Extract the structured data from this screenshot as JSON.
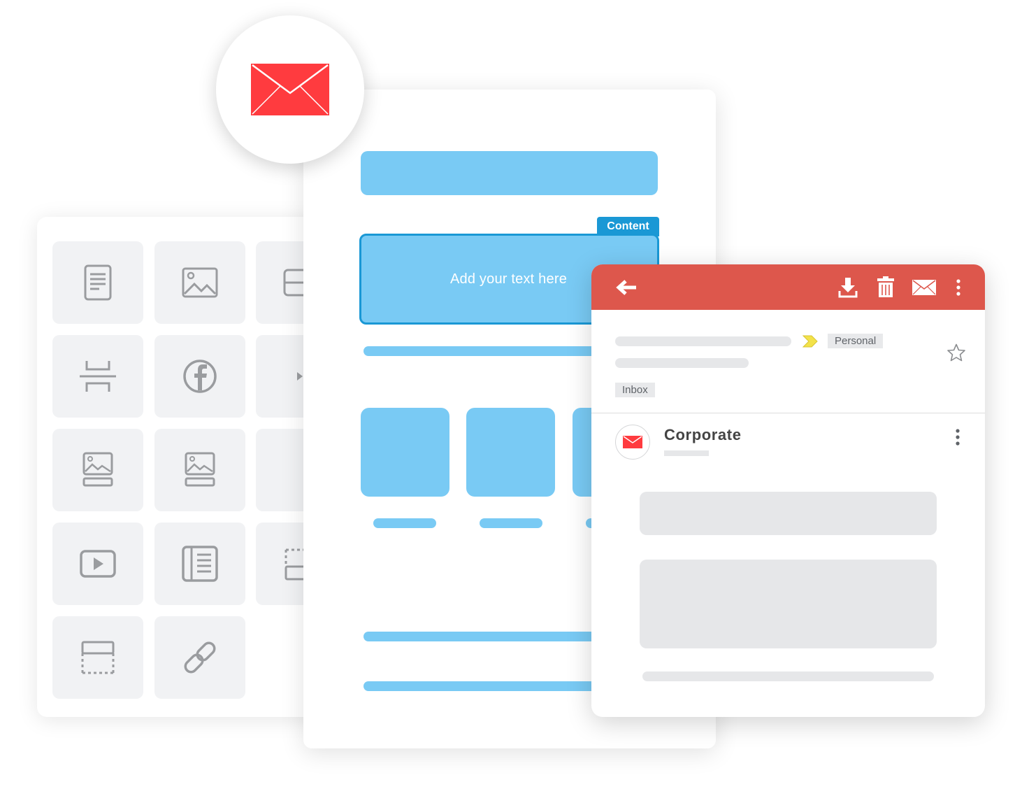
{
  "editor": {
    "content_tag": "Content",
    "content_placeholder": "Add your text here"
  },
  "client": {
    "tags": {
      "personal": "Personal",
      "inbox": "Inbox"
    },
    "sender": "Corporate"
  },
  "blocks_panel": {
    "tiles": [
      "text-block-icon",
      "image-block-icon",
      "button-block-icon",
      "spacer-block-icon",
      "facebook-icon",
      "divider-block-icon",
      "image-caption-icon",
      "image-caption-icon",
      "image-text-icon",
      "video-icon",
      "article-icon",
      "html-block-icon",
      "footer-block-icon",
      "link-icon"
    ]
  },
  "colors": {
    "accent_blue": "#79caf4",
    "selection_blue": "#1a98d5",
    "mail_red": "#ff3b3f",
    "client_bar": "#dd574c"
  }
}
